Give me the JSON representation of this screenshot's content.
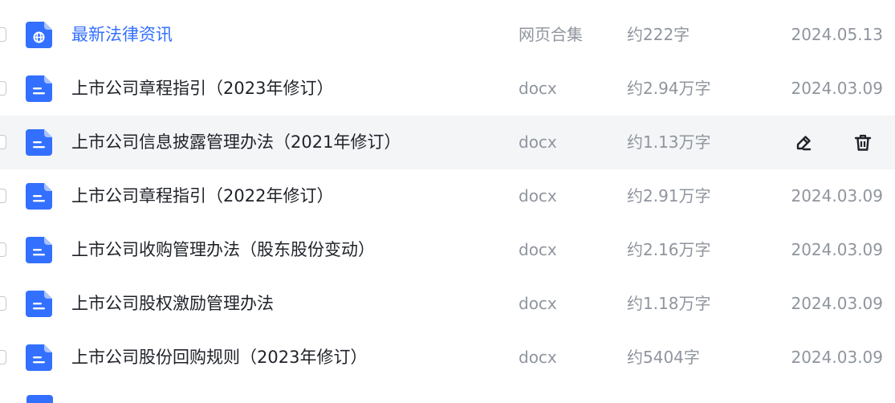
{
  "colors": {
    "accent": "#3370ff",
    "text": "#1f2329",
    "muted": "#8f959e",
    "hover_bg": "#f4f5f7"
  },
  "rows": [
    {
      "icon": "globe-icon",
      "name": "最新法律资讯",
      "type": "网页合集",
      "size": "约222字",
      "date": "2024.05.13",
      "link": true
    },
    {
      "icon": "docx-icon",
      "name": "上市公司章程指引（2023年修订）",
      "type": "docx",
      "size": "约2.94万字",
      "date": "2024.03.09"
    },
    {
      "icon": "docx-icon",
      "name": "上市公司信息披露管理办法（2021年修订）",
      "type": "docx",
      "size": "约1.13万字",
      "date": "",
      "hover": true
    },
    {
      "icon": "docx-icon",
      "name": "上市公司章程指引（2022年修订）",
      "type": "docx",
      "size": "约2.91万字",
      "date": "2024.03.09"
    },
    {
      "icon": "docx-icon",
      "name": "上市公司收购管理办法（股东股份变动）",
      "type": "docx",
      "size": "约2.16万字",
      "date": "2024.03.09"
    },
    {
      "icon": "docx-icon",
      "name": "上市公司股权激励管理办法",
      "type": "docx",
      "size": "约1.18万字",
      "date": "2024.03.09"
    },
    {
      "icon": "docx-icon",
      "name": "上市公司股份回购规则（2023年修订）",
      "type": "docx",
      "size": "约5404字",
      "date": "2024.03.09"
    }
  ],
  "row_actions": {
    "edit_icon": "edit-pencil-icon",
    "delete_icon": "trash-icon"
  }
}
